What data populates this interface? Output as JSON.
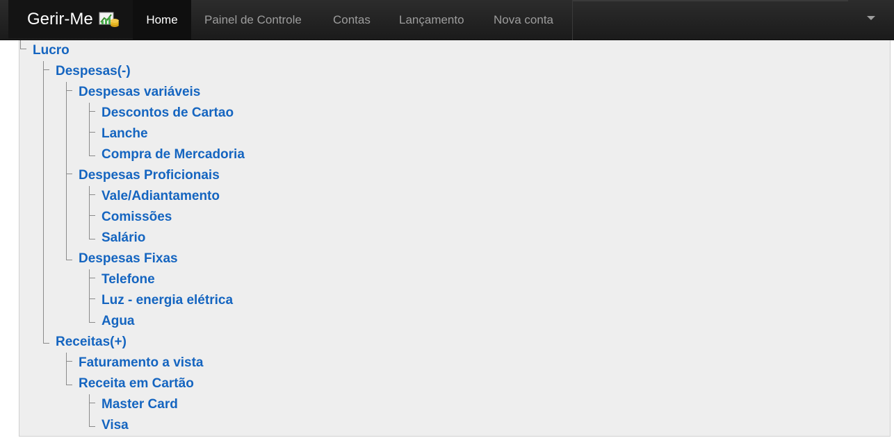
{
  "navbar": {
    "brand": "Gerir-Me",
    "brand_icon": "chart-money-icon",
    "items": [
      {
        "label": "Home",
        "active": true
      },
      {
        "label": "Painel de Controle",
        "active": false
      },
      {
        "label": "Contas",
        "active": false
      },
      {
        "label": "Lançamento",
        "active": false
      },
      {
        "label": "Nova conta",
        "active": false
      }
    ],
    "dropdown_icon": "caret-down-icon"
  },
  "tree": {
    "root": "Lucro",
    "despesas": {
      "label": "Despesas(-)",
      "variaveis": {
        "label": "Despesas variáveis",
        "items": [
          "Descontos de Cartao",
          "Lanche",
          "Compra de Mercadoria"
        ]
      },
      "proficionais": {
        "label": "Despesas Proficionais",
        "items": [
          "Vale/Adiantamento",
          "Comissões",
          "Salário"
        ]
      },
      "fixas": {
        "label": "Despesas Fixas",
        "items": [
          "Telefone",
          "Luz - energia elétrica",
          "Agua"
        ]
      }
    },
    "receitas": {
      "label": "Receitas(+)",
      "faturamento": "Faturamento a vista",
      "cartao": {
        "label": "Receita em Cartão",
        "items": [
          "Master Card",
          "Visa"
        ]
      }
    }
  },
  "colors": {
    "navbar_bg": "#222222",
    "link": "#1565c0",
    "content_bg": "#eeeeee"
  }
}
